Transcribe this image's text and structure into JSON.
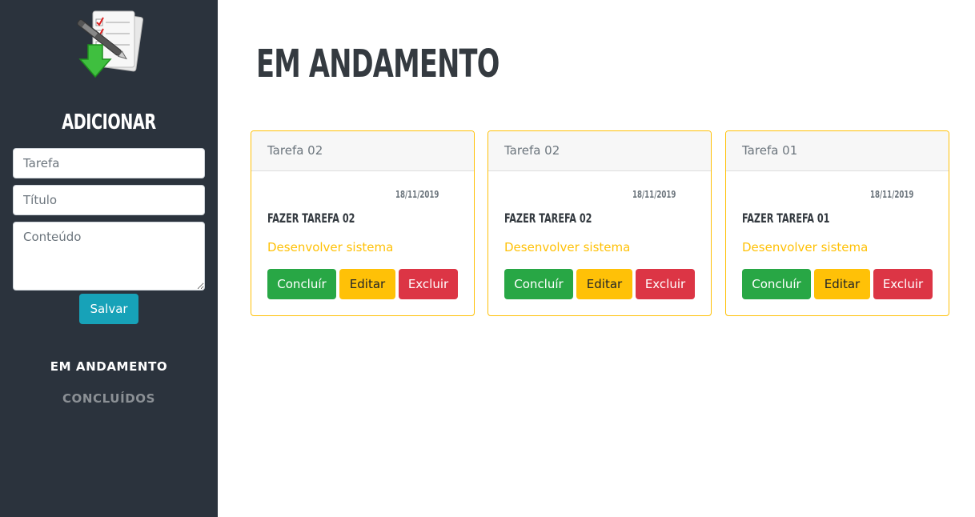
{
  "sidebar": {
    "logo_icon": "task-download-icon",
    "add_title": "ADICIONAR",
    "fields": {
      "tarefa_placeholder": "Tarefa",
      "titulo_placeholder": "Título",
      "conteudo_placeholder": "Conteúdo"
    },
    "save_label": "Salvar",
    "nav": [
      {
        "label": "EM ANDAMENTO"
      },
      {
        "label": "CONCLUÍDOS"
      }
    ]
  },
  "main": {
    "title": "EM ANDAMENTO",
    "cards": [
      {
        "header": "Tarefa 02",
        "date": "18/11/2019",
        "title": "FAZER TAREFA 02",
        "text": "Desenvolver sistema",
        "buttons": {
          "concluir": "Concluír",
          "editar": "Editar",
          "excluir": "Excluir"
        }
      },
      {
        "header": "Tarefa 02",
        "date": "18/11/2019",
        "title": "FAZER TAREFA 02",
        "text": "Desenvolver sistema",
        "buttons": {
          "concluir": "Concluír",
          "editar": "Editar",
          "excluir": "Excluir"
        }
      },
      {
        "header": "Tarefa 01",
        "date": "18/11/2019",
        "title": "FAZER TAREFA 01",
        "text": "Desenvolver sistema",
        "buttons": {
          "concluir": "Concluír",
          "editar": "Editar",
          "excluir": "Excluir"
        }
      }
    ]
  },
  "colors": {
    "sidebar_bg": "#2b333d",
    "card_border": "#ffc107",
    "success": "#28a745",
    "warning": "#ffc107",
    "danger": "#dc3545",
    "info": "#17a2b8"
  }
}
